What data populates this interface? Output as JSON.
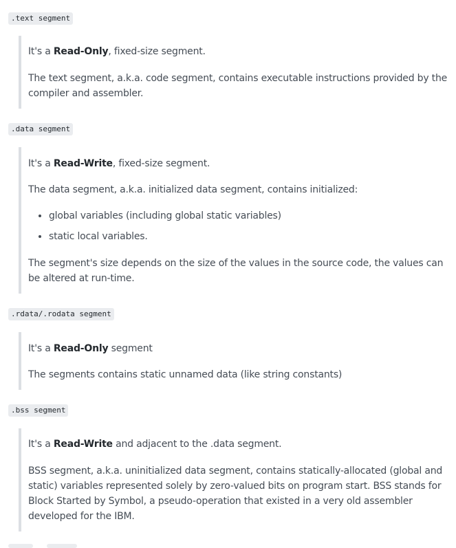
{
  "text_segment": {
    "title": ".text segment",
    "line1_pre": "It's a ",
    "line1_bold": "Read-Only",
    "line1_post": ", fixed-size segment.",
    "para2": "The text segment, a.k.a. code segment, contains executable instructions provided by the compiler and assembler."
  },
  "data_segment": {
    "title": ".data segment",
    "line1_pre": "It's a ",
    "line1_bold": "Read-Write",
    "line1_post": ", fixed-size segment.",
    "para2": "The data segment, a.k.a. initialized data segment, contains initialized:",
    "bullets": [
      "global variables (including global static variables)",
      "static local variables."
    ],
    "para3": "The segment's size depends on the size of the values in the source code, the values can be altered at run-time."
  },
  "rodata_segment": {
    "title": ".rdata/.rodata segment",
    "line1_pre": "It's a ",
    "line1_bold": "Read-Only",
    "line1_post": " segment",
    "para2": "The segments contains static unnamed data (like string constants)"
  },
  "bss_segment": {
    "title": ".bss segment",
    "line1_pre": "It's a ",
    "line1_bold": "Read-Write",
    "line1_post": " and adjacent to the .data segment.",
    "para2": "BSS segment, a.k.a. uninitialized data segment, contains statically-allocated (global and static) variables represented solely by zero-valued bits on program start. BSS stands for Block Started by Symbol, a pseudo-operation that existed in a very old assembler developed for the IBM."
  }
}
